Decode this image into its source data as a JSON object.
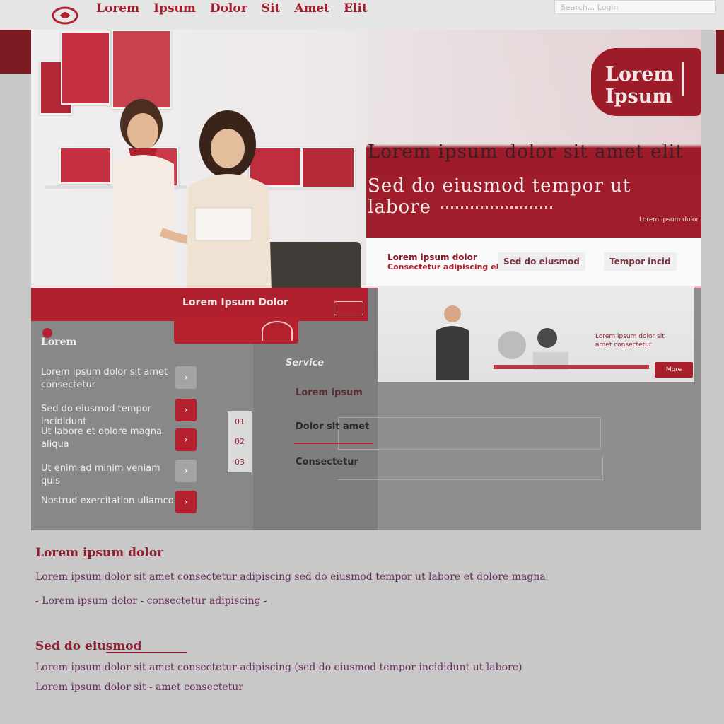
{
  "header": {
    "nav": [
      "Lorem",
      "Ipsum",
      "Dolor",
      "Sit",
      "Amet",
      "Elit"
    ],
    "search_placeholder": "Search...  Login"
  },
  "hero": {
    "badge": "Lorem Ipsum",
    "headline_1": "Lorem ipsum dolor sit amet elit",
    "headline_2": "Sed do eiusmod tempor ut labore",
    "caption": "Lorem ipsum dolor",
    "tab_1_title": "Lorem ipsum dolor",
    "tab_1_sub": "Consectetur adipiscing elit",
    "tab_2_label": "Sed do eiusmod",
    "tab_3_label": "Tempor incid"
  },
  "services": {
    "bar_label": "Lorem Ipsum Dolor",
    "title": "Lorem",
    "items": [
      "Lorem ipsum dolor sit amet consectetur",
      "Sed do eiusmod tempor incididunt",
      "Ut labore et dolore magna aliqua",
      "Ut enim ad minim veniam quis",
      "Nostrud exercitation ullamco"
    ],
    "side_values": [
      "01",
      "02",
      "03"
    ]
  },
  "form": {
    "title": "Service",
    "row_1": "Lorem ipsum",
    "row_2": "Dolor sit amet",
    "row_3": "Consectetur"
  },
  "promo": {
    "text": "Lorem ipsum dolor sit amet consectetur",
    "button": "More"
  },
  "content": {
    "heading_1": "Lorem ipsum dolor",
    "line_1": "Lorem ipsum  dolor  sit amet  consectetur adipiscing  sed do eiusmod tempor  ut labore et dolore magna",
    "line_2": "- Lorem  ipsum dolor  - consectetur adipiscing -",
    "heading_2": "Sed do eiusmod",
    "line_3": "Lorem ipsum dolor sit amet consectetur adipiscing (sed do eiusmod tempor incididunt ut labore)",
    "line_4": "Lorem   ipsum dolor  sit  -  amet   consectetur"
  },
  "colors": {
    "brand": "#a51c2b",
    "dark_red": "#7b1a20",
    "panel_grey": "#8f8e8e"
  }
}
